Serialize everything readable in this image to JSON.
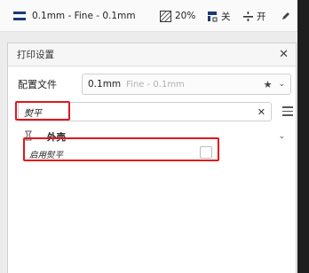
{
  "toolbar": {
    "profile_text": "0.1mm - Fine - 0.1mm",
    "infill_value": "20%",
    "support_value": "关",
    "adhesion_value": "开",
    "icons": [
      "printer-profile-icon",
      "infill-icon",
      "support-icon",
      "adhesion-icon",
      "edit-icon"
    ]
  },
  "panel": {
    "title": "打印设置",
    "close_icon": "close-icon",
    "profile_label": "配置文件",
    "profile_value": "0.1mm",
    "profile_sub": "Fine - 0.1mm",
    "search_value": "熨平",
    "category_label": "外壳",
    "setting_label": "启用熨平",
    "setting_checked": false
  },
  "colors": {
    "highlight": "#e0161e",
    "dark_strip": "#1e1e1e"
  }
}
